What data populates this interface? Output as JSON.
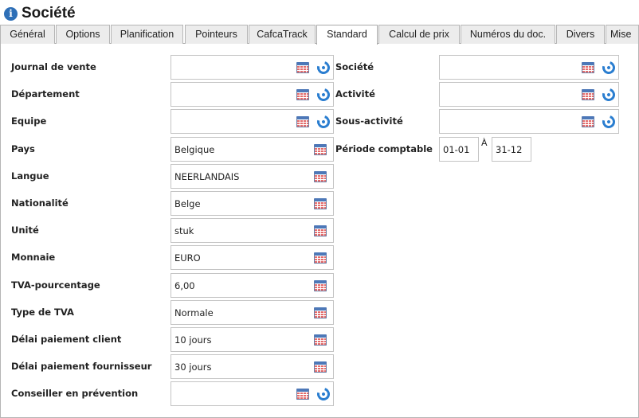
{
  "header": {
    "title": "Société"
  },
  "tabs": [
    "Général",
    "Options",
    "Planification",
    "Pointeurs",
    "CafcaTrack",
    "Standard",
    "Calcul de prix",
    "Numéros du doc.",
    "Divers",
    "Mise"
  ],
  "active_tab": "Standard",
  "left_fields": [
    {
      "label": "Journal de vente",
      "value": "",
      "icons": [
        "calendar",
        "reset"
      ]
    },
    {
      "label": "Département",
      "value": "",
      "icons": [
        "calendar",
        "reset"
      ]
    },
    {
      "label": "Equipe",
      "value": "",
      "icons": [
        "calendar",
        "reset"
      ]
    },
    {
      "label": "Pays",
      "value": "Belgique",
      "icons": [
        "calendar"
      ]
    },
    {
      "label": "Langue",
      "value": "NEERLANDAIS",
      "icons": [
        "calendar"
      ]
    },
    {
      "label": "Nationalité",
      "value": "Belge",
      "icons": [
        "calendar"
      ]
    },
    {
      "label": "Unité",
      "value": "stuk",
      "icons": [
        "calendar"
      ]
    },
    {
      "label": "Monnaie",
      "value": "EURO",
      "icons": [
        "calendar"
      ]
    },
    {
      "label": "TVA-pourcentage",
      "value": "6,00",
      "icons": [
        "calendar"
      ]
    },
    {
      "label": "Type de TVA",
      "value": "Normale",
      "icons": [
        "calendar"
      ]
    },
    {
      "label": "Délai paiement client",
      "value": "10 jours",
      "icons": [
        "calendar"
      ]
    },
    {
      "label": "Délai paiement fournisseur",
      "value": "30 jours",
      "icons": [
        "calendar"
      ]
    },
    {
      "label": "Conseiller en prévention",
      "value": "",
      "icons": [
        "calendar",
        "reset"
      ]
    }
  ],
  "right_fields": [
    {
      "label": "Société",
      "value": "",
      "icons": [
        "calendar",
        "reset"
      ]
    },
    {
      "label": "Activité",
      "value": "",
      "icons": [
        "calendar",
        "reset"
      ]
    },
    {
      "label": "Sous-activité",
      "value": "",
      "icons": [
        "calendar",
        "reset"
      ]
    }
  ],
  "periode": {
    "label": "Période comptable",
    "from": "01-01",
    "separator": "À",
    "to": "31-12"
  },
  "colors": {
    "info_icon": "#2e6fb7",
    "reset_icon": "#2b7ed0",
    "calendar_stripes": "#e36b6b"
  }
}
